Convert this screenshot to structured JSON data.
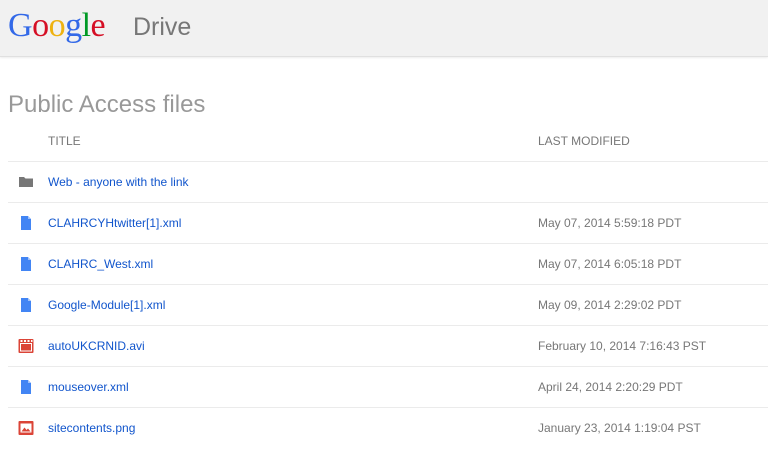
{
  "header": {
    "logo_letters": [
      "G",
      "o",
      "o",
      "g",
      "l",
      "e"
    ],
    "logo_colors": [
      "#3369e8",
      "#d50f25",
      "#eeb211",
      "#3369e8",
      "#009925",
      "#d50f25"
    ],
    "product_name": "Drive"
  },
  "page": {
    "title": "Public Access files"
  },
  "columns": {
    "title": "TITLE",
    "last_modified": "LAST MODIFIED"
  },
  "colors": {
    "link": "#1155cc",
    "folder_icon": "#777777",
    "doc_icon": "#4285f4",
    "video_icon": "#db4437",
    "image_icon": "#db4437"
  },
  "files": [
    {
      "name": "Web - anyone with the link",
      "modified": "",
      "icon": "folder-icon"
    },
    {
      "name": "CLAHRCYHtwitter[1].xml",
      "modified": "May 07, 2014 5:59:18 PDT",
      "icon": "document-icon"
    },
    {
      "name": "CLAHRC_West.xml",
      "modified": "May 07, 2014 6:05:18 PDT",
      "icon": "document-icon"
    },
    {
      "name": "Google-Module[1].xml",
      "modified": "May 09, 2014 2:29:02 PDT",
      "icon": "document-icon"
    },
    {
      "name": "autoUKCRNID.avi",
      "modified": "February 10, 2014 7:16:43 PST",
      "icon": "video-icon"
    },
    {
      "name": "mouseover.xml",
      "modified": "April 24, 2014 2:20:29 PDT",
      "icon": "document-icon"
    },
    {
      "name": "sitecontents.png",
      "modified": "January 23, 2014 1:19:04 PST",
      "icon": "image-icon"
    }
  ]
}
